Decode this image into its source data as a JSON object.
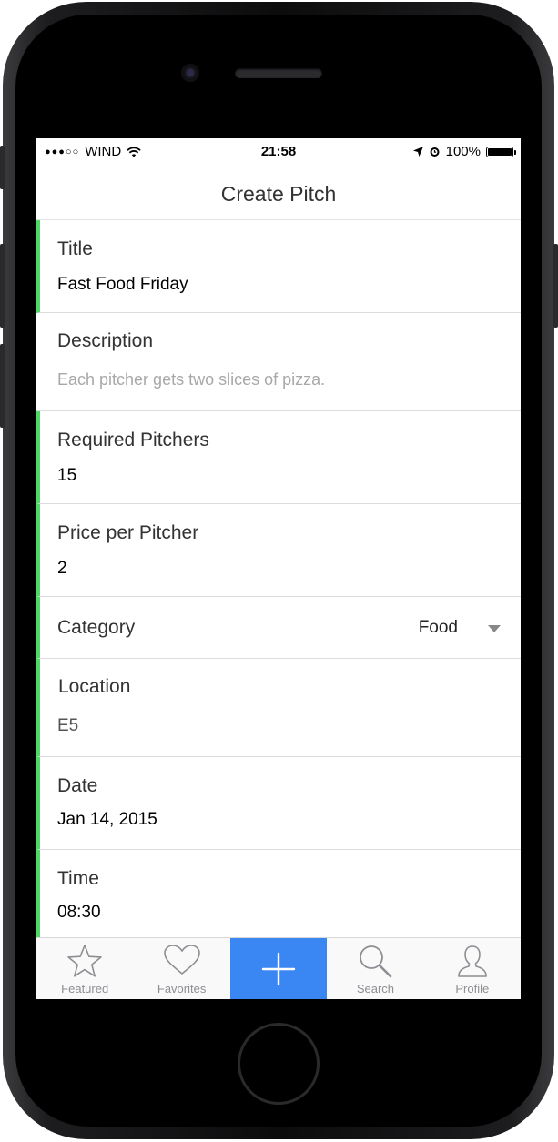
{
  "status_bar": {
    "carrier": "WIND",
    "time": "21:58",
    "battery": "100%"
  },
  "nav": {
    "title": "Create Pitch"
  },
  "form": {
    "title": {
      "label": "Title",
      "value": "Fast Food Friday"
    },
    "description": {
      "label": "Description",
      "placeholder": "Each pitcher gets two slices of pizza."
    },
    "required_pitchers": {
      "label": "Required Pitchers",
      "value": "15"
    },
    "price_per_pitcher": {
      "label": "Price per Pitcher",
      "value": "2"
    },
    "category": {
      "label": "Category",
      "value": "Food"
    },
    "location": {
      "label": "Location",
      "value": "E5"
    },
    "date": {
      "label": "Date",
      "value": "Jan 14, 2015"
    },
    "time": {
      "label": "Time",
      "value": "08:30"
    }
  },
  "tabbar": {
    "items": [
      {
        "label": "Featured",
        "icon": "star-icon"
      },
      {
        "label": "Favorites",
        "icon": "heart-icon"
      },
      {
        "label": "",
        "icon": "plus-icon"
      },
      {
        "label": "Search",
        "icon": "search-icon"
      },
      {
        "label": "Profile",
        "icon": "profile-icon"
      }
    ]
  },
  "colors": {
    "accent_bar": "#4cd964",
    "add_tab": "#3a86f2",
    "tab_inactive": "#8e8e93"
  }
}
